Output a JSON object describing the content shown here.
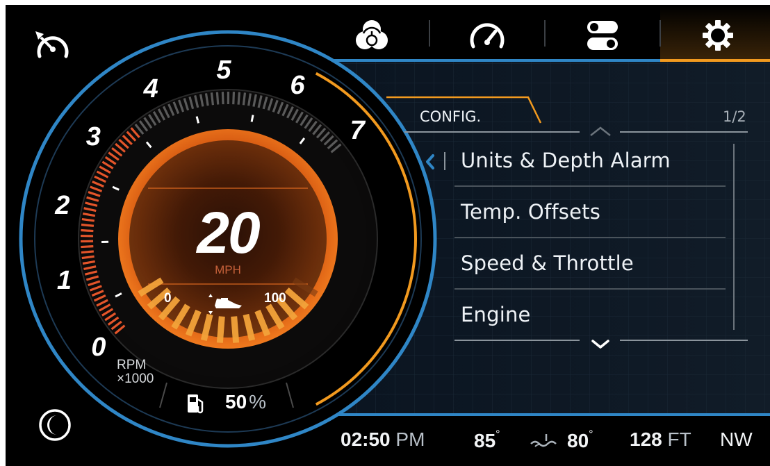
{
  "top_nav": {
    "items": [
      {
        "name": "color-themes",
        "icon": "rgb-circles-icon"
      },
      {
        "name": "gauges",
        "icon": "speedometer-icon"
      },
      {
        "name": "toggles",
        "icon": "toggle-switches-icon"
      },
      {
        "name": "settings",
        "icon": "gear-icon",
        "active": true
      }
    ]
  },
  "gauge": {
    "rpm_ticks": [
      "0",
      "1",
      "2",
      "3",
      "4",
      "5",
      "6",
      "7"
    ],
    "rpm_label": "RPM",
    "rpm_multiplier": "×1000",
    "rpm_value": 3.5,
    "speed_value": "20",
    "speed_unit": "MPH",
    "throttle_min": "0",
    "throttle_max": "100",
    "throttle_fraction": 0.6,
    "fuel_value": "50",
    "fuel_unit": "%"
  },
  "config": {
    "title": "CONFIG.",
    "page": "1/2",
    "items": [
      "Units & Depth Alarm",
      "Temp. Offsets",
      "Speed & Throttle",
      "Engine"
    ]
  },
  "status": {
    "time": "02:50",
    "ampm": "PM",
    "air_temp": "85",
    "water_temp": "80",
    "degree": "°",
    "depth": "128",
    "depth_unit": "FT",
    "heading": "NW"
  },
  "colors": {
    "accent_orange": "#f29a1f",
    "accent_blue": "#2f86c6",
    "rpm_active": "#e4552a",
    "background": "#000000"
  }
}
